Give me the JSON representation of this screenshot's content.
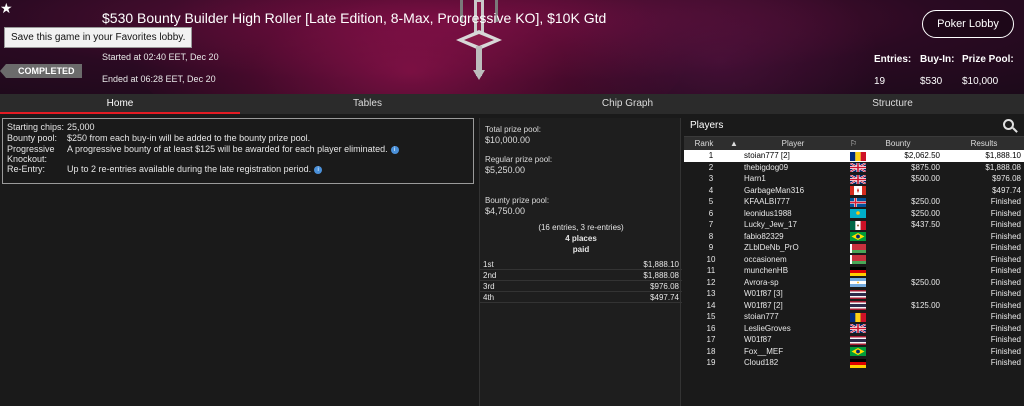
{
  "header": {
    "title": "$530 Bounty Builder High Roller [Late Edition, 8-Max, Progressive KO], $10K Gtd",
    "favorite_tooltip": "Save this game in your Favorites lobby.",
    "started": "Started at 02:40 EET, Dec 20",
    "ended": "Ended at 06:28 EET, Dec 20",
    "status": "COMPLETED",
    "lobby_button": "Poker Lobby",
    "stats": [
      {
        "label": "Entries:",
        "value": "19"
      },
      {
        "label": "Buy-In:",
        "value": "$530"
      },
      {
        "label": "Prize Pool:",
        "value": "$10,000"
      }
    ]
  },
  "tabs": [
    "Home",
    "Tables",
    "Chip Graph",
    "Structure"
  ],
  "info": [
    {
      "key": "Starting chips:",
      "value": "25,000",
      "info": false
    },
    {
      "key": "Bounty pool:",
      "value": "$250 from each buy-in will be added to the bounty prize pool.",
      "info": false
    },
    {
      "key": "Progressive Knockout:",
      "value": "A progressive bounty of at least $125 will be awarded for each player eliminated.",
      "info": true
    },
    {
      "key": "Re-Entry:",
      "value": "Up to 2 re-entries available during the late registration period.",
      "info": true
    }
  ],
  "prizes": {
    "total_label": "Total prize pool:",
    "total_value": "$10,000.00",
    "regular_label": "Regular prize pool:",
    "regular_value": "$5,250.00",
    "bounty_label": "Bounty prize pool:",
    "bounty_value": "$4,750.00",
    "entries_note": "(16 entries, 3 re-entries)",
    "places_line1": "4 places",
    "places_line2": "paid",
    "places": [
      {
        "place": "1st",
        "amount": "$1,888.10"
      },
      {
        "place": "2nd",
        "amount": "$1,888.08"
      },
      {
        "place": "3rd",
        "amount": "$976.08"
      },
      {
        "place": "4th",
        "amount": "$497.74"
      }
    ]
  },
  "players": {
    "title": "Players",
    "columns": {
      "rank": "Rank",
      "player": "Player",
      "bounty": "Bounty",
      "results": "Results"
    },
    "rows": [
      {
        "rank": "1",
        "name": "stoian777 [2]",
        "flag": "romania",
        "bounty": "$2,062.50",
        "result": "$1,888.10"
      },
      {
        "rank": "2",
        "name": "thebigdog09",
        "flag": "uk",
        "bounty": "$875.00",
        "result": "$1,888.08"
      },
      {
        "rank": "3",
        "name": "Harn1",
        "flag": "uk",
        "bounty": "$500.00",
        "result": "$976.08"
      },
      {
        "rank": "4",
        "name": "GarbageMan316",
        "flag": "canada",
        "bounty": "",
        "result": "$497.74"
      },
      {
        "rank": "5",
        "name": "KFAALBI777",
        "flag": "iceland",
        "bounty": "$250.00",
        "result": "Finished"
      },
      {
        "rank": "6",
        "name": "leonidus1988",
        "flag": "kazakhstan",
        "bounty": "$250.00",
        "result": "Finished"
      },
      {
        "rank": "7",
        "name": "Lucky_Jew_17",
        "flag": "mexico",
        "bounty": "$437.50",
        "result": "Finished"
      },
      {
        "rank": "8",
        "name": "fabio82329",
        "flag": "brazil",
        "bounty": "",
        "result": "Finished"
      },
      {
        "rank": "9",
        "name": "ZLblDeNb_PrO",
        "flag": "belarus",
        "bounty": "",
        "result": "Finished"
      },
      {
        "rank": "10",
        "name": "occasionem",
        "flag": "belarus",
        "bounty": "",
        "result": "Finished"
      },
      {
        "rank": "11",
        "name": "munchenHB",
        "flag": "germany",
        "bounty": "",
        "result": "Finished"
      },
      {
        "rank": "12",
        "name": "Avrora-sp",
        "flag": "argentina",
        "bounty": "$250.00",
        "result": "Finished"
      },
      {
        "rank": "13",
        "name": "W01f87 [3]",
        "flag": "thailand",
        "bounty": "",
        "result": "Finished"
      },
      {
        "rank": "14",
        "name": "W01f87 [2]",
        "flag": "thailand",
        "bounty": "$125.00",
        "result": "Finished"
      },
      {
        "rank": "15",
        "name": "stoian777",
        "flag": "romania",
        "bounty": "",
        "result": "Finished"
      },
      {
        "rank": "16",
        "name": "LeslieGroves",
        "flag": "uk",
        "bounty": "",
        "result": "Finished"
      },
      {
        "rank": "17",
        "name": "W01f87",
        "flag": "thailand",
        "bounty": "",
        "result": "Finished"
      },
      {
        "rank": "18",
        "name": "Fox__MEF",
        "flag": "brazil",
        "bounty": "",
        "result": "Finished"
      },
      {
        "rank": "19",
        "name": "Cloud182",
        "flag": "germany",
        "bounty": "",
        "result": "Finished"
      }
    ]
  },
  "colors": {
    "accent": "#e31b23",
    "header_bg": "#4a0d30",
    "panel_bg": "#1a1a1a"
  }
}
